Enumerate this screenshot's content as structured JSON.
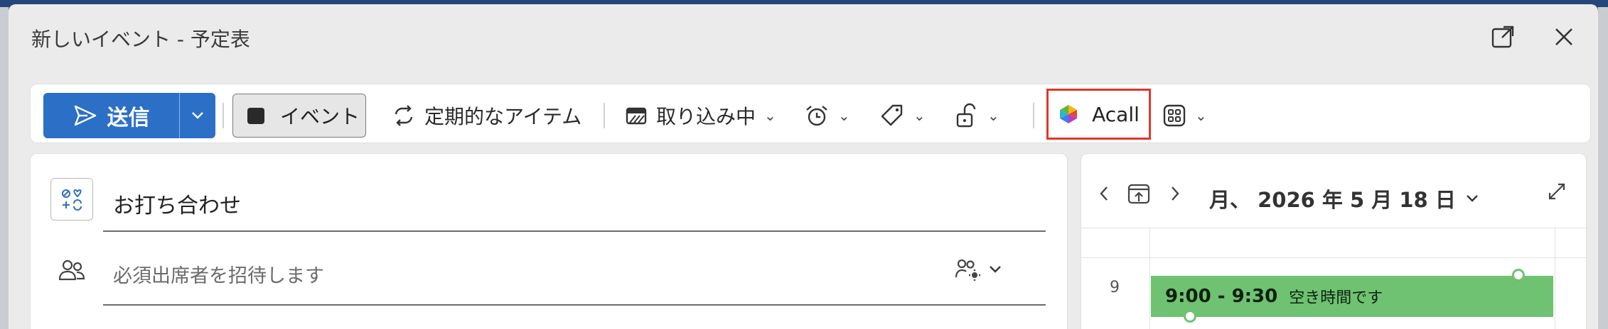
{
  "window": {
    "title": "新しいイベント - 予定表"
  },
  "titlebar": {
    "popout_icon": "popout-icon",
    "close_icon": "close-icon"
  },
  "toolbar": {
    "send_label": "送信",
    "event_label": "イベント",
    "recurring_label": "定期的なアイテム",
    "busy_label": "取り込み中",
    "acall_label": "Acall"
  },
  "form": {
    "title_value": "お打ち合わせ",
    "attendees_placeholder": "必須出席者を招待します"
  },
  "calendar": {
    "date_label": "月、 2026 年 5 月 18 日",
    "hour_label": "9",
    "event_time": "9:00 - 9:30",
    "event_status": "空き時間です",
    "event_color": "#6ec271"
  },
  "colors": {
    "accent": "#2b6fc6",
    "highlight": "#e0372a"
  }
}
